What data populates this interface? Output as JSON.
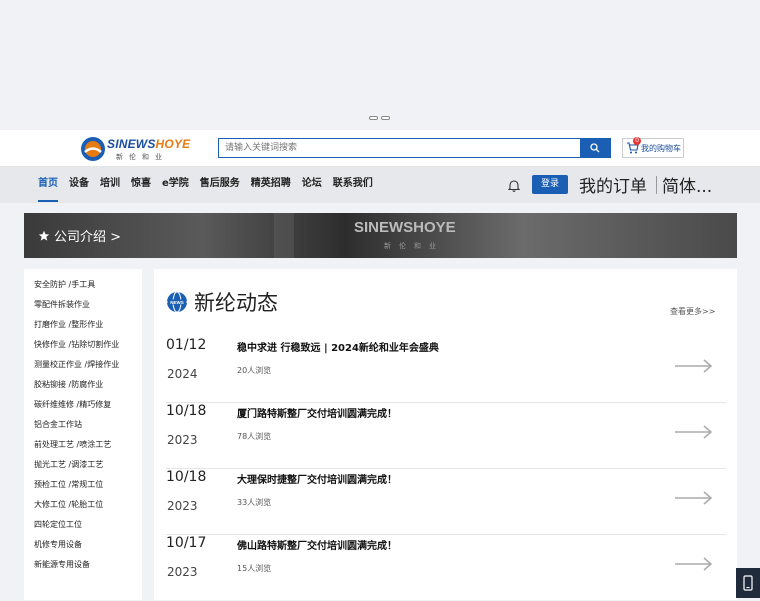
{
  "header": {
    "logo_text_main": "SINEWS",
    "logo_text_accent": "HOYE",
    "logo_sub": "新伦和业",
    "search_placeholder": "请输入关键词搜索",
    "cart_label": "我的购物车",
    "cart_count": "0"
  },
  "nav": {
    "items": [
      {
        "label": "首页"
      },
      {
        "label": "设备"
      },
      {
        "label": "培训"
      },
      {
        "label": "惊喜"
      },
      {
        "label": "e学院"
      },
      {
        "label": "售后服务"
      },
      {
        "label": "精英招聘"
      },
      {
        "label": "论坛"
      },
      {
        "label": "联系我们"
      }
    ],
    "login_label": "登录",
    "orders_label": "我的订单",
    "lang_label": "简体..."
  },
  "banner": {
    "label": "公司介绍 >",
    "brand": "SINEWSHOYE",
    "brand_sub": "新伦和业"
  },
  "sidebar": {
    "items": [
      {
        "label": "安全防护 /手工具"
      },
      {
        "label": "零配件拆装作业"
      },
      {
        "label": "打磨作业 /整形作业"
      },
      {
        "label": "快修作业 /钻除切割作业"
      },
      {
        "label": "测量校正作业 /焊接作业"
      },
      {
        "label": "胶粘铆接 /防腐作业"
      },
      {
        "label": "碳纤维维修 /精巧修复"
      },
      {
        "label": "铝合金工作站"
      },
      {
        "label": "前处理工艺 /喷涂工艺"
      },
      {
        "label": "抛光工艺 /调漆工艺"
      },
      {
        "label": "预检工位 /常规工位"
      },
      {
        "label": "大修工位 /轮胎工位"
      },
      {
        "label": "四轮定位工位"
      },
      {
        "label": "机修专用设备"
      },
      {
        "label": "新能源专用设备"
      }
    ]
  },
  "news": {
    "logo_text": "NEWS",
    "title": "新纶动态",
    "more_label": "查看更多>>",
    "items": [
      {
        "date": "01/12",
        "year": "2024",
        "title": "稳中求进 行稳致远 | 2024新纶和业年会盛典",
        "views": "20人浏览"
      },
      {
        "date": "10/18",
        "year": "2023",
        "title": "厦门路特斯整厂交付培训圆满完成！",
        "views": "78人浏览"
      },
      {
        "date": "10/18",
        "year": "2023",
        "title": "大理保时捷整厂交付培训圆满完成！",
        "views": "33人浏览"
      },
      {
        "date": "10/17",
        "year": "2023",
        "title": "佛山路特斯整厂交付培训圆满完成！",
        "views": "15人浏览"
      }
    ]
  },
  "colors": {
    "brand_blue": "#1a5fb4",
    "accent_orange": "#e87a12"
  }
}
